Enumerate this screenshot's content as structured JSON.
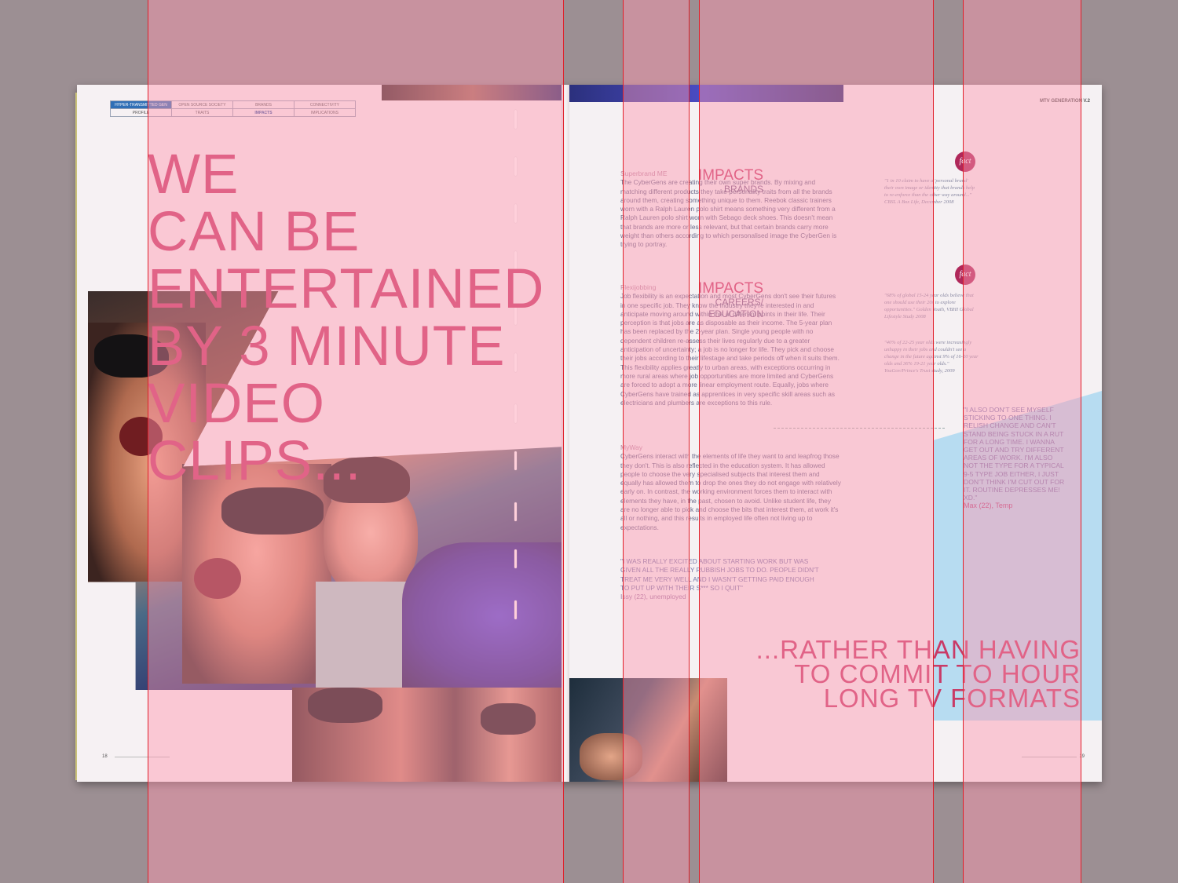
{
  "left_page": {
    "nav_top": [
      "HYPER-TRANSMITTED GEN",
      "OPEN SOURCE SOCIETY",
      "BRANDS",
      "CONNECTIVITY"
    ],
    "nav_bottom": [
      "PROFILE",
      "TRAITS",
      "IMPACTS",
      "IMPLICATIONS"
    ],
    "headline": [
      "WE",
      "CAN BE",
      "ENTERTAINED",
      "BY 3 MINUTE",
      "VIDEO",
      "CLIPS..."
    ],
    "page_number": "18"
  },
  "right_page": {
    "running_head": "MTV GENERATION V.2",
    "page_number": "19",
    "section_brands": {
      "title": "IMPACTS",
      "subtitle": "BRANDS"
    },
    "section_careers": {
      "title": "IMPACTS",
      "subtitle_lines": [
        "CAREERS/",
        "EDUCATION"
      ]
    },
    "articles": [
      {
        "heading": "Superbrand ME",
        "body": "The CyberGens are creating their own super brands. By mixing and matching different products they take personality traits from all the brands around them, creating something unique to them. Reebok classic trainers worn with a Ralph Lauren polo shirt means something very different from a Ralph Lauren polo shirt worn with Sebago deck shoes. This doesn't mean that brands are more or less relevant, but that certain brands carry more weight than others according to which personalised image the CyberGen is trying to portray."
      },
      {
        "heading": "Flexijobbing",
        "body": "Job flexibility is an expectation and most CyberGens don't see their futures in one specific job. They know the industry they're interested in and anticipate moving around within this at different points in their life. Their perception is that jobs are as disposable as their income. The 5-year plan has been replaced by the 2-year plan. Single young people with no dependent children re-assess their lives regularly due to a greater anticipation of uncertainty; a job is no longer for life. They pick and choose their jobs according to their lifestage and take periods off when it suits them. This flexibility applies greatly to urban areas, with exceptions occurring in more rural areas where job opportunities are more limited and CyberGens are forced to adopt a more linear employment route. Equally, jobs where CyberGens have trained as apprentices in very specific skill areas such as electricians and plumbers are exceptions to this rule."
      },
      {
        "heading": "MyWay",
        "body": "CyberGens interact with the elements of life they want to and leapfrog those they don't. This is also reflected in the education system. It has allowed people to choose the very specialised subjects that interest them and equally has allowed them to drop the ones they do not engage with relatively early on. In contrast, the working environment forces them to interact with elements they have, in the past, chosen to avoid. Unlike student life, they are no longer able to pick and choose the bits that interest them, at work it's all or nothing, and this results in employed life often not living up to expectations."
      }
    ],
    "quote_1": {
      "text": "\"I WAS REALLY EXCITED ABOUT STARTING WORK BUT WAS GIVEN ALL THE REALLY RUBBISH JOBS TO DO. PEOPLE DIDN'T TREAT ME VERY WELL AND I WASN'T GETTING PAID ENOUGH TO PUT UP WITH THEIR S*** SO I QUIT\"",
      "attribution": "Issy (22), unemployed"
    },
    "fact_badge": "fact",
    "fact_1": "\"1 in 10 claim to have a 'personal brand' their own image or identity that brands help to re-enforce than the other way around...\" CBSL A Box Life, December 2008",
    "fact_2a": "\"68% of global 15-24 year olds believe that one should use their 20s to explore opportunities.\" Golden Youth, VBHI Global Lifestyle Study 2008",
    "fact_2b": "\"40% of 22-25 year olds were increasingly unhappy in their jobs and couldn't see a change in the future against 9% of 16-20 year olds and 36% 19-21 year olds.\" YouGov/Prince's Trust study, 2009",
    "quote_2": {
      "text": "\"I ALSO DON'T SEE MYSELF STICKING TO ONE THING. I RELISH CHANGE AND CAN'T STAND BEING STUCK IN A RUT FOR A LONG TIME. I WANNA GET OUT AND TRY DIFFERENT AREAS OF WORK. I'M ALSO NOT THE TYPE FOR A TYPICAL 9-5 TYPE JOB EITHER, I JUST DON'T THINK I'M CUT OUT FOR IT. ROUTINE DEPRESSES ME! xD.\"",
      "attribution": "Max (22), Temp"
    },
    "bottom_headline": [
      "...RATHER THAN HAVING",
      "TO COMMIT TO HOUR",
      "LONG TV FORMATS"
    ]
  },
  "colors": {
    "headline": "#c93a66",
    "nav_highlight": "#2f6fb6",
    "overlay": "#ff96af",
    "guide_line": "#e0202a"
  }
}
